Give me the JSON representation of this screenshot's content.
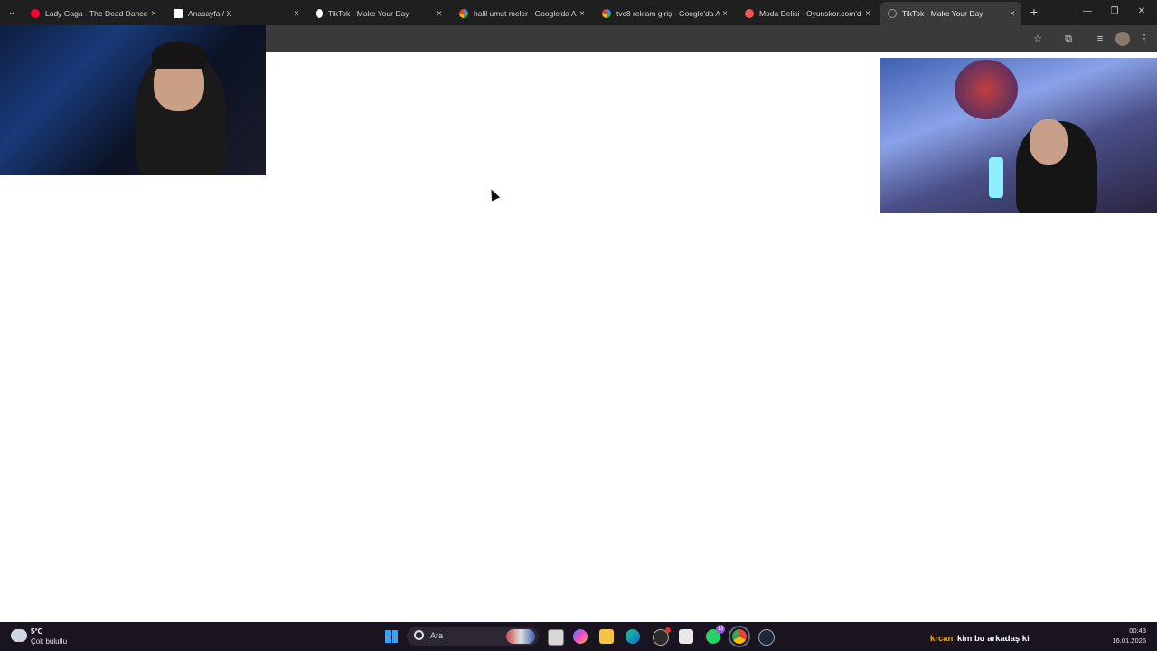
{
  "tabs": [
    {
      "title": "Lady Gaga - The Dead Dance (",
      "favicon": "youtube-icon",
      "color": "#ff0033"
    },
    {
      "title": "Anasayfa / X",
      "favicon": "x-icon",
      "color": "#ffffff"
    },
    {
      "title": "TikTok - Make Your Day",
      "favicon": "tiktok-icon",
      "color": "#ffffff"
    },
    {
      "title": "halil umut meler - Google'da A",
      "favicon": "google-icon",
      "color": "#ffffff"
    },
    {
      "title": "tvc8 reklam giriş - Google'da A",
      "favicon": "google-icon",
      "color": "#ffffff"
    },
    {
      "title": "Moda Delisi - Oyunskor.com'd",
      "favicon": "oyunskor-icon",
      "color": "#e85a5a"
    },
    {
      "title": "TikTok - Make Your Day",
      "favicon": "tiktok-loading-icon",
      "color": "#9a9a9a"
    }
  ],
  "icons": {
    "tab_close": "×",
    "new_tab": "+",
    "minimize": "—",
    "maximize": "❐",
    "close": "✕",
    "dropdown": "⌄",
    "bookmark": "☆",
    "extensions": "⧉",
    "media": "≡",
    "menu": "⋮"
  },
  "taskbar": {
    "weather_temp": "5°C",
    "weather_desc": "Çok bulutlu",
    "search_label": "Ara",
    "whatsapp_badge": "13"
  },
  "chat": {
    "user": "krcan",
    "message": "kim bu arkadaş ki"
  },
  "clock": {
    "time": "00:43",
    "date": "16.01.2026"
  }
}
